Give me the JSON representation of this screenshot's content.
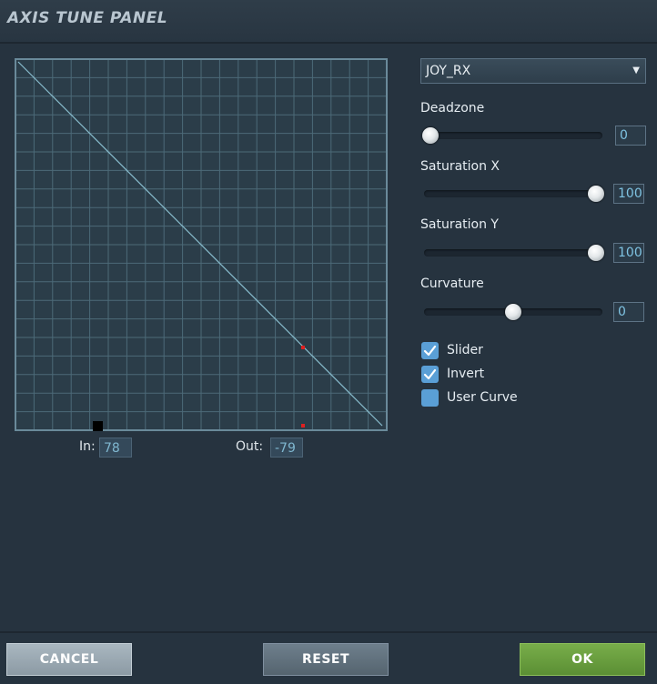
{
  "window": {
    "title": "AXIS TUNE PANEL"
  },
  "graph": {
    "in_label": "In:",
    "in_value": "78",
    "out_label": "Out:",
    "out_value": "-79"
  },
  "axis_select": {
    "selected": "JOY_RX"
  },
  "params": {
    "deadzone": {
      "label": "Deadzone",
      "value": "0",
      "slider_fraction": 0.0
    },
    "saturation_x": {
      "label": "Saturation X",
      "value": "100",
      "slider_fraction": 1.0
    },
    "saturation_y": {
      "label": "Saturation Y",
      "value": "100",
      "slider_fraction": 1.0
    },
    "curvature": {
      "label": "Curvature",
      "value": "0",
      "slider_fraction": 0.5
    }
  },
  "options": {
    "slider": {
      "label": "Slider",
      "checked": true
    },
    "invert": {
      "label": "Invert",
      "checked": true
    },
    "user_curve": {
      "label": "User Curve",
      "checked": false
    }
  },
  "buttons": {
    "cancel": "CANCEL",
    "reset": "RESET",
    "ok": "OK"
  },
  "colors": {
    "accent_ok": "#6a9e3f",
    "checkbox": "#5a9fd6",
    "curve_line": "#88bccd",
    "marker": "#e02020"
  }
}
